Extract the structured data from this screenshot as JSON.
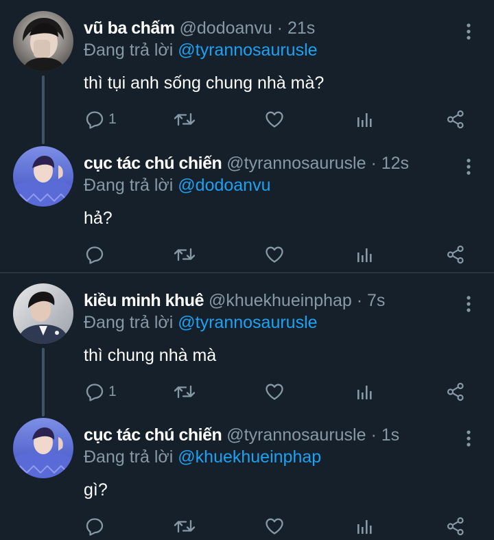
{
  "tweets": [
    {
      "name": "vũ ba chấm",
      "handle": "@dodoanvu",
      "dot": " · ",
      "time": "21s",
      "reply_prefix": "Đang trả lời ",
      "reply_to": "@tyrannosaurusle",
      "text": "thì tụi anh sống chung nhà mà?",
      "reply_count": "1",
      "avatar": "avatar-dark-hair-boy"
    },
    {
      "name": "cục tác chú chiến",
      "handle": "@tyrannosaurusle",
      "dot": " · ",
      "time": "12s",
      "reply_prefix": "Đang trả lời ",
      "reply_to": "@dodoanvu",
      "text": "hả?",
      "reply_count": "",
      "avatar": "avatar-blue-argyle"
    },
    {
      "name": "kiều minh khuê",
      "handle": "@khuekhueinphap",
      "dot": " · ",
      "time": "7s",
      "reply_prefix": "Đang trả lời ",
      "reply_to": "@tyrannosaurusle",
      "text": "thì chung nhà mà",
      "reply_count": "1",
      "avatar": "avatar-suit-man"
    },
    {
      "name": "cục tác chú chiến",
      "handle": "@tyrannosaurusle",
      "dot": " · ",
      "time": "1s",
      "reply_prefix": "Đang trả lời ",
      "reply_to": "@khuekhueinphap",
      "text": "gì?",
      "reply_count": "",
      "avatar": "avatar-blue-argyle"
    }
  ],
  "colors": {
    "background": "#15202b",
    "text": "#ffffff",
    "secondary": "#8899a6",
    "mention": "#1da1f2",
    "thread_line": "#3d5466",
    "divider": "#38444d"
  },
  "icons": [
    "reply-icon",
    "retweet-icon",
    "like-icon",
    "analytics-icon",
    "share-icon",
    "more-icon"
  ]
}
